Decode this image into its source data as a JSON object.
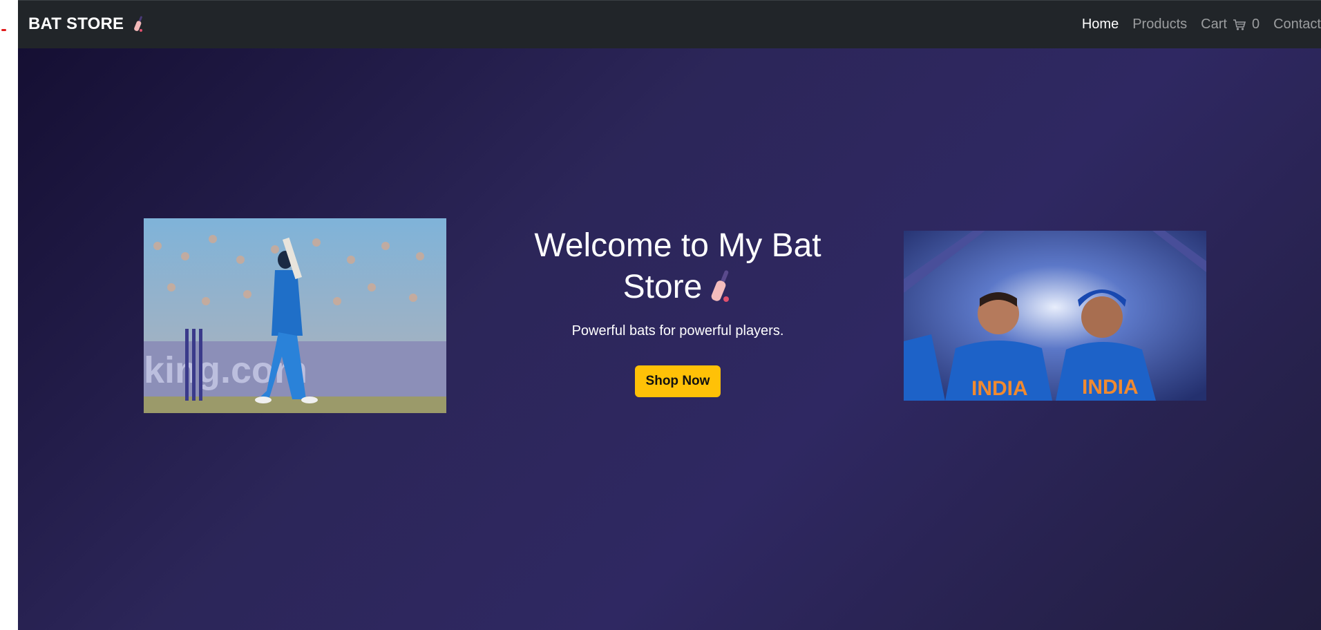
{
  "navbar": {
    "brand": "BAT STORE",
    "brand_icon": "cricket-bat-icon",
    "links": [
      {
        "label": "Home",
        "active": true
      },
      {
        "label": "Products",
        "active": false
      },
      {
        "label": "Cart",
        "count": "0",
        "icon": "shopping-cart-icon"
      },
      {
        "label": "Contact",
        "active": false
      }
    ]
  },
  "hero": {
    "title": "Welcome to My Bat Store",
    "title_icon": "cricket-bat-icon",
    "tagline": "Powerful bats for powerful players.",
    "button_label": "Shop Now",
    "left_image": "batsman-playing-shot-photo",
    "right_image": "two-india-players-celebrating-photo"
  },
  "colors": {
    "navbar_bg": "#212529",
    "hero_gradient_start": "#150f33",
    "hero_gradient_mid": "#2f2862",
    "button_bg": "#ffc107",
    "text_primary": "#ffffff"
  }
}
